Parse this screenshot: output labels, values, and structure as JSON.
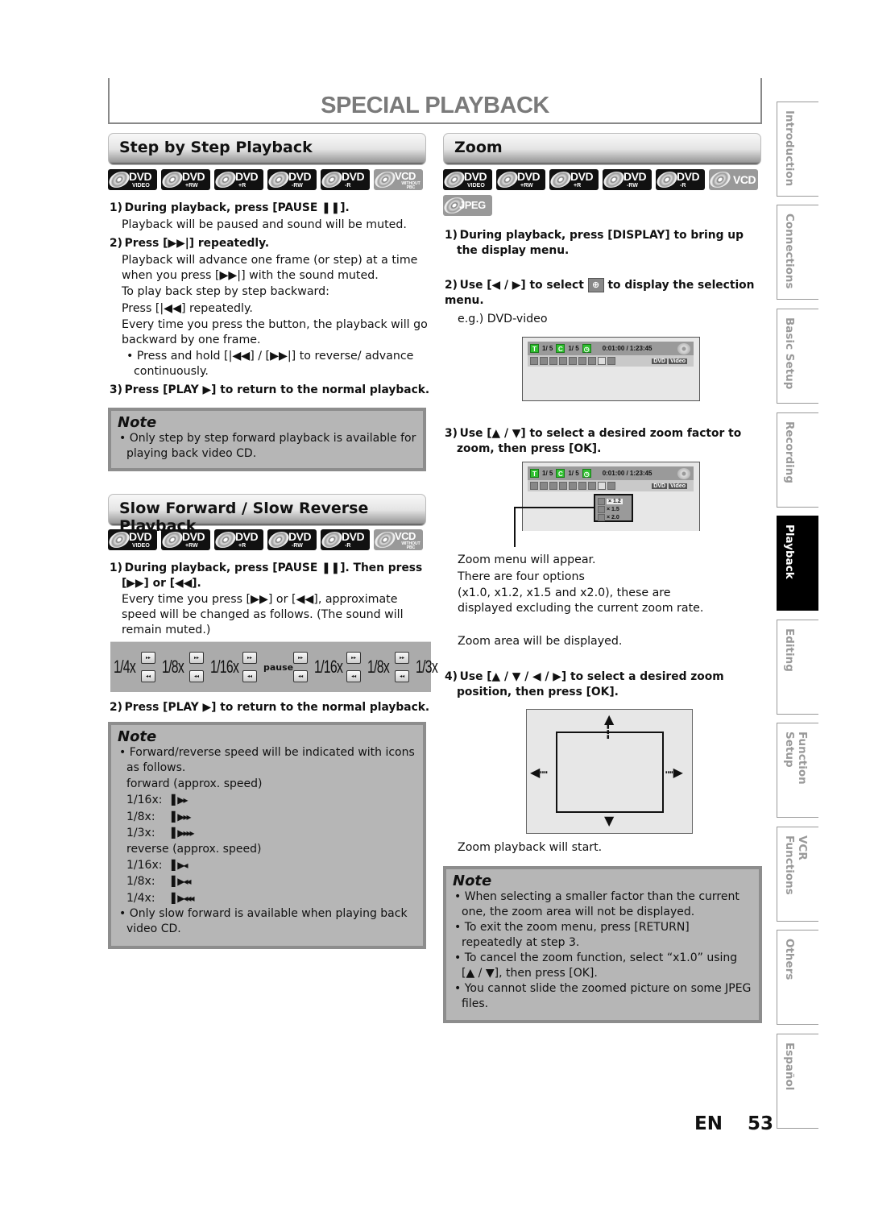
{
  "page_title": "SPECIAL PLAYBACK",
  "disc_badges_main": [
    {
      "main": "DVD",
      "sub": "VIDEO",
      "style": "dark"
    },
    {
      "main": "DVD",
      "sub": "+RW",
      "style": "dark"
    },
    {
      "main": "DVD",
      "sub": "+R",
      "style": "dark"
    },
    {
      "main": "DVD",
      "sub": "-RW",
      "style": "dark"
    },
    {
      "main": "DVD",
      "sub": "-R",
      "style": "dark"
    },
    {
      "main": "VCD",
      "sub": "WITHOUT PBC",
      "style": "gray"
    }
  ],
  "step_by_step": {
    "header": "Step by Step Playback",
    "step1_title": "1) During playback, press [PAUSE ❚❚].",
    "step1_body": "Playback will be paused and sound will be muted.",
    "step2_title": "2) Press [▶▶|] repeatedly.",
    "step2_body1": "Playback will advance one frame (or step) at a time when you press [▶▶|] with the sound muted.",
    "step2_body2": "To play back step by step backward:",
    "step2_body3": "Press [|◀◀] repeatedly.",
    "step2_body4": "Every time you press the button, the playback will go backward by one frame.",
    "step2_bullet": "• Press and hold [|◀◀] / [▶▶|] to reverse/ advance continuously.",
    "step3_title": "3) Press [PLAY ▶] to return to the normal playback.",
    "note_title": "Note",
    "note_items": [
      "• Only step by step forward playback is available for playing back video CD."
    ]
  },
  "slow_playback": {
    "header": "Slow Forward / Slow Reverse Playback",
    "step1_title": "1) During playback, press [PAUSE ❚❚]. Then press [▶▶] or [◀◀].",
    "step1_body": "Every time you press [▶▶] or [◀◀], approximate speed will be changed as follows. (The sound will remain muted.)",
    "speed_chart": [
      "1/4x",
      "1/8x",
      "1/16x",
      "pause",
      "1/16x",
      "1/8x",
      "1/3x"
    ],
    "btn_fwd": "▸▸",
    "btn_rev": "◂◂",
    "step2_title": "2) Press [PLAY ▶] to return to the normal playback.",
    "note_title": "Note",
    "note_bullet1": "• Forward/reverse speed will be indicated with icons as follows.",
    "forward_label": "forward (approx. speed)",
    "forward_speeds": [
      {
        "label": "1/16x:",
        "icon": "▌▶▸"
      },
      {
        "label": "1/8x:",
        "icon": "▌▶▸▸"
      },
      {
        "label": "1/3x:",
        "icon": "▌▶▸▸▸"
      }
    ],
    "reverse_label": "reverse (approx. speed)",
    "reverse_speeds": [
      {
        "label": "1/16x:",
        "icon": "▌▶◂"
      },
      {
        "label": "1/8x:",
        "icon": "▌▶◂◂"
      },
      {
        "label": "1/4x:",
        "icon": "▌▶◂◂◂"
      }
    ],
    "note_bullet2": "• Only slow forward is available when playing back video CD."
  },
  "zoom": {
    "header": "Zoom",
    "badges": [
      {
        "main": "DVD",
        "sub": "VIDEO",
        "style": "dark"
      },
      {
        "main": "DVD",
        "sub": "+RW",
        "style": "dark"
      },
      {
        "main": "DVD",
        "sub": "+R",
        "style": "dark"
      },
      {
        "main": "DVD",
        "sub": "-RW",
        "style": "dark"
      },
      {
        "main": "DVD",
        "sub": "-R",
        "style": "dark"
      },
      {
        "main": "VCD",
        "sub": "",
        "style": "gray"
      },
      {
        "main": "JPEG",
        "sub": "",
        "style": "gray"
      }
    ],
    "step1_title": "1) During playback, press [DISPLAY] to bring up the display menu.",
    "step2_title_a": "2) Use [◀ / ▶] to select",
    "step2_title_b": "to display the selection menu.",
    "step2_eg": "e.g.) DVD-video",
    "osd": {
      "title_label": "T",
      "title_val": "1/  5",
      "chapter_label": "C",
      "chapter_val": "1/  5",
      "time": "0:01:00 / 1:23:45",
      "tag1": "DVD",
      "tag2": "Video"
    },
    "step3_title": "3) Use [▲ / ▼] to select a desired zoom factor to zoom, then press [OK].",
    "zoom_options": [
      "× 1.2",
      "× 1.5",
      "× 2.0"
    ],
    "step3_body1": "Zoom menu will appear.",
    "step3_body2": "There are four options",
    "step3_body3": "(x1.0, x1.2, x1.5 and x2.0), these are displayed excluding the current zoom rate.",
    "step3_body4": "Zoom area will be displayed.",
    "step4_title": "4) Use [▲ / ▼ / ◀ / ▶] to select a desired zoom position, then press [OK].",
    "step4_body": "Zoom playback will start.",
    "note_title": "Note",
    "note_items": [
      "• When selecting a smaller factor than the current one, the zoom area will not be displayed.",
      "• To exit the zoom menu, press [RETURN] repeatedly at step 3.",
      "• To cancel the zoom function, select “x1.0” using [▲ / ▼], then press [OK].",
      "• You cannot slide the zoomed picture on some JPEG files."
    ]
  },
  "side_tabs": [
    {
      "label": "Introduction",
      "active": false
    },
    {
      "label": "Connections",
      "active": false
    },
    {
      "label": "Basic Setup",
      "active": false
    },
    {
      "label": "Recording",
      "active": false
    },
    {
      "label": "Playback",
      "active": true
    },
    {
      "label": "Editing",
      "active": false
    },
    {
      "label": "Function Setup",
      "active": false
    },
    {
      "label": "VCR Functions",
      "active": false
    },
    {
      "label": "Others",
      "active": false
    },
    {
      "label": "Español",
      "active": false
    }
  ],
  "footer": {
    "lang": "EN",
    "page": "53"
  }
}
